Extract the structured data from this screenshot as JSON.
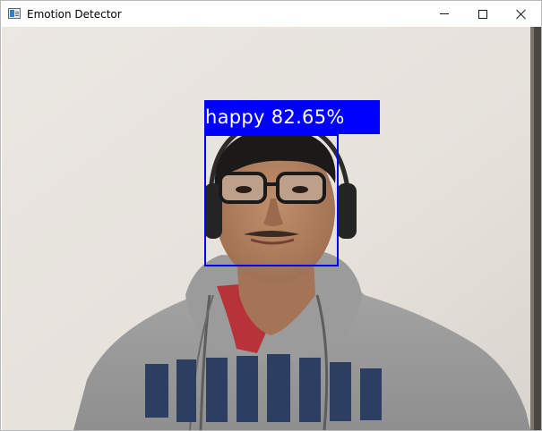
{
  "window": {
    "title": "Emotion Detector",
    "icons": {
      "app": "app-window-icon",
      "minimize": "minimize-icon",
      "maximize": "maximize-icon",
      "close": "close-icon"
    }
  },
  "detection": {
    "label": "happy 82.65%",
    "box_color": "#0000ff",
    "text_color": "#ffffff"
  }
}
